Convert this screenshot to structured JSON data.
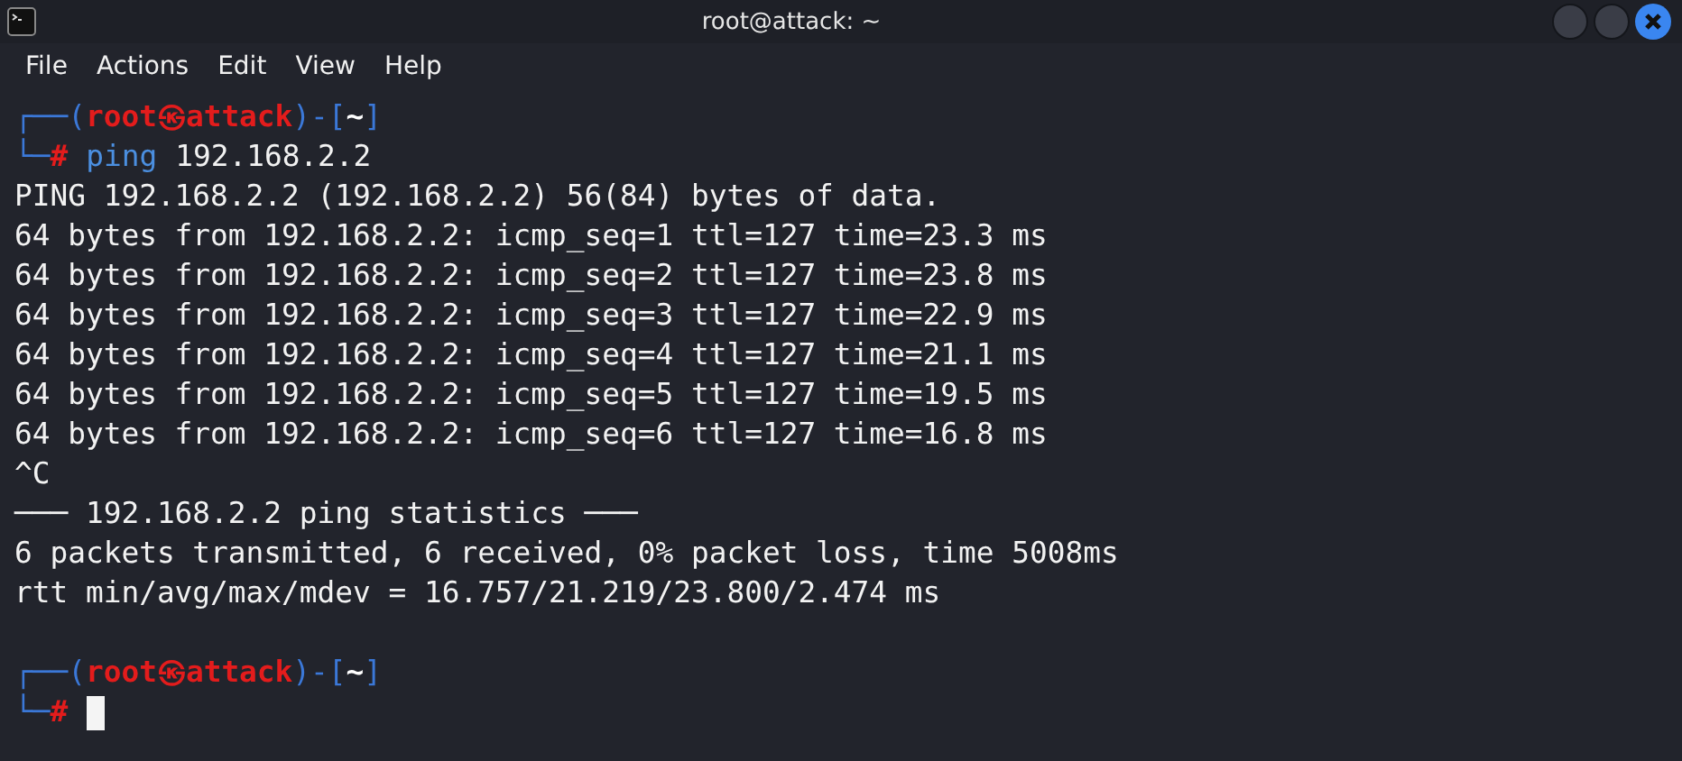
{
  "window": {
    "title": "root@attack: ~"
  },
  "menu": [
    "File",
    "Actions",
    "Edit",
    "View",
    "Help"
  ],
  "terminal": {
    "lines": [
      {
        "kind": "prompt",
        "segments": [
          {
            "kind": "frame",
            "text": "┌──("
          },
          {
            "kind": "user",
            "text": "root㉿attack"
          },
          {
            "kind": "frame",
            "text": ")-["
          },
          {
            "kind": "dir",
            "text": "~"
          },
          {
            "kind": "frame",
            "text": "]"
          }
        ]
      },
      {
        "kind": "prompt",
        "segments": [
          {
            "kind": "frame",
            "text": "└─"
          },
          {
            "kind": "hash",
            "text": "#"
          },
          {
            "kind": "command",
            "text": "ping"
          },
          {
            "kind": "args",
            "text": "192.168.2.2"
          }
        ]
      },
      {
        "kind": "output",
        "text": "PING 192.168.2.2 (192.168.2.2) 56(84) bytes of data."
      },
      {
        "kind": "output",
        "text": "64 bytes from 192.168.2.2: icmp_seq=1 ttl=127 time=23.3 ms"
      },
      {
        "kind": "output",
        "text": "64 bytes from 192.168.2.2: icmp_seq=2 ttl=127 time=23.8 ms"
      },
      {
        "kind": "output",
        "text": "64 bytes from 192.168.2.2: icmp_seq=3 ttl=127 time=22.9 ms"
      },
      {
        "kind": "output",
        "text": "64 bytes from 192.168.2.2: icmp_seq=4 ttl=127 time=21.1 ms"
      },
      {
        "kind": "output",
        "text": "64 bytes from 192.168.2.2: icmp_seq=5 ttl=127 time=19.5 ms"
      },
      {
        "kind": "output",
        "text": "64 bytes from 192.168.2.2: icmp_seq=6 ttl=127 time=16.8 ms"
      },
      {
        "kind": "output",
        "text": "^C"
      },
      {
        "kind": "output",
        "text": "─── 192.168.2.2 ping statistics ───"
      },
      {
        "kind": "output",
        "text": "6 packets transmitted, 6 received, 0% packet loss, time 5008ms"
      },
      {
        "kind": "output",
        "text": "rtt min/avg/max/mdev = 16.757/21.219/23.800/2.474 ms"
      },
      {
        "kind": "blank"
      },
      {
        "kind": "prompt",
        "segments": [
          {
            "kind": "frame",
            "text": "┌──("
          },
          {
            "kind": "user",
            "text": "root㉿attack"
          },
          {
            "kind": "frame",
            "text": ")-["
          },
          {
            "kind": "dir",
            "text": "~"
          },
          {
            "kind": "frame",
            "text": "]"
          }
        ]
      },
      {
        "kind": "prompt",
        "segments": [
          {
            "kind": "frame",
            "text": "└─"
          },
          {
            "kind": "hash",
            "text": "#"
          },
          {
            "kind": "cursor"
          }
        ]
      }
    ]
  }
}
